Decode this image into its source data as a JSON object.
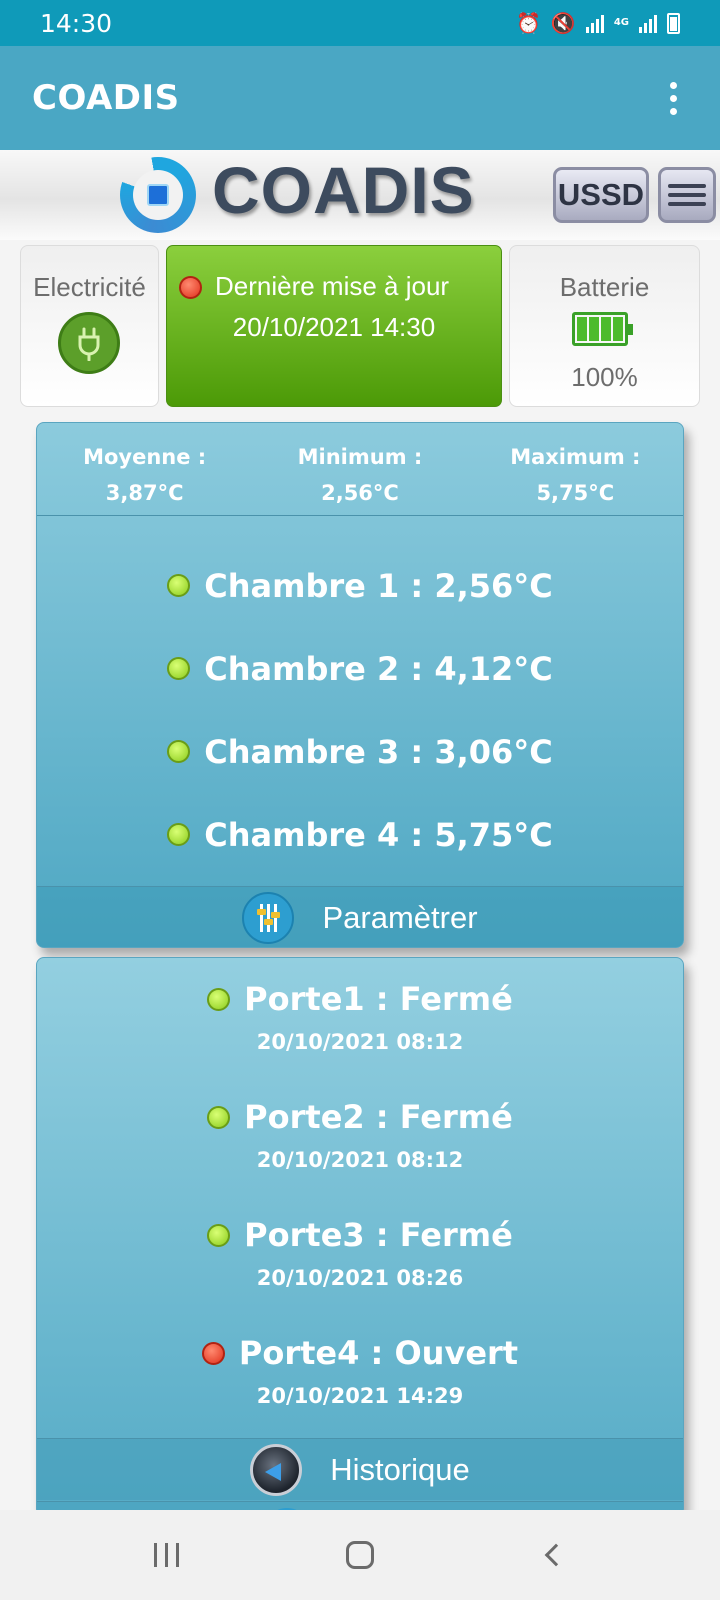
{
  "status_bar": {
    "time": "14:30",
    "network": "4G"
  },
  "app_bar": {
    "title": "COADIS"
  },
  "header": {
    "logo_text": "COADIS",
    "ussd_label": "USSD"
  },
  "tiles": {
    "electricity": {
      "label": "Electricité"
    },
    "update": {
      "title": "Dernière mise à jour",
      "datetime": "20/10/2021 14:30",
      "status": "red"
    },
    "battery": {
      "label": "Batterie",
      "percent": "100%",
      "level": 1.0
    }
  },
  "temperature": {
    "stats": [
      {
        "label": "Moyenne :",
        "value": "3,87°C"
      },
      {
        "label": "Minimum :",
        "value": "2,56°C"
      },
      {
        "label": "Maximum :",
        "value": "5,75°C"
      }
    ],
    "chambers": [
      {
        "label": "Chambre 1 : 2,56°C",
        "status": "green"
      },
      {
        "label": "Chambre 2 : 4,12°C",
        "status": "green"
      },
      {
        "label": "Chambre 3 : 3,06°C",
        "status": "green"
      },
      {
        "label": "Chambre 4 : 5,75°C",
        "status": "green"
      }
    ],
    "settings_label": "Paramètrer"
  },
  "doors": {
    "items": [
      {
        "label": "Porte1 : Fermé",
        "datetime": "20/10/2021 08:12",
        "status": "green"
      },
      {
        "label": "Porte2 : Fermé",
        "datetime": "20/10/2021 08:12",
        "status": "green"
      },
      {
        "label": "Porte3 : Fermé",
        "datetime": "20/10/2021 08:26",
        "status": "green"
      },
      {
        "label": "Porte4 : Ouvert",
        "datetime": "20/10/2021 14:29",
        "status": "red"
      }
    ],
    "history_label": "Historique"
  },
  "icons": {
    "electricity": "plug-icon",
    "battery": "battery-icon",
    "settings": "sliders-icon",
    "history": "history-icon",
    "menu": "hamburger-icon",
    "overflow": "more-vert-icon"
  },
  "colors": {
    "accent": "#4aa7c4",
    "status_green": "#8ccc1d",
    "status_red": "#e0311c",
    "update_tile": "#6db524"
  }
}
